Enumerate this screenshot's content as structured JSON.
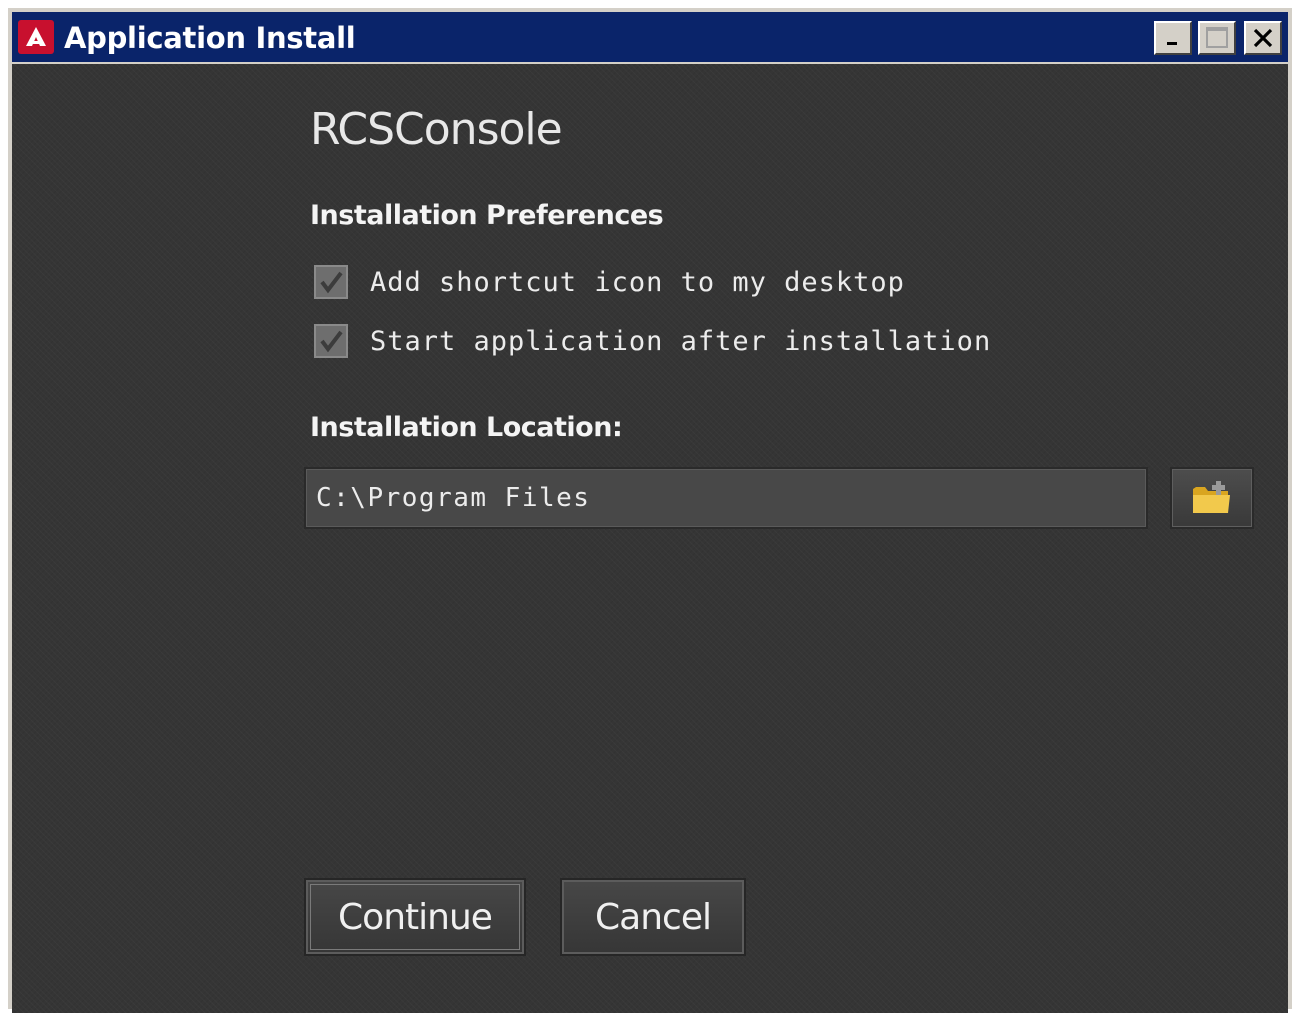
{
  "window": {
    "title": "Application Install",
    "controls": {
      "minimize": "minimize-icon",
      "maximize": "maximize-icon",
      "close": "close-icon"
    }
  },
  "app": {
    "name": "RCSConsole"
  },
  "preferences": {
    "heading": "Installation Preferences",
    "options": [
      {
        "label": "Add shortcut icon to my desktop",
        "checked": true
      },
      {
        "label": "Start application after installation",
        "checked": true
      }
    ]
  },
  "location": {
    "heading": "Installation Location:",
    "path": "C:\\Program Files",
    "browse_icon": "folder-icon"
  },
  "actions": {
    "continue_label": "Continue",
    "cancel_label": "Cancel"
  },
  "colors": {
    "titlebar": "#0a246a",
    "background": "#353535",
    "logo": "#c8102e",
    "folder": "#f2c94c"
  }
}
